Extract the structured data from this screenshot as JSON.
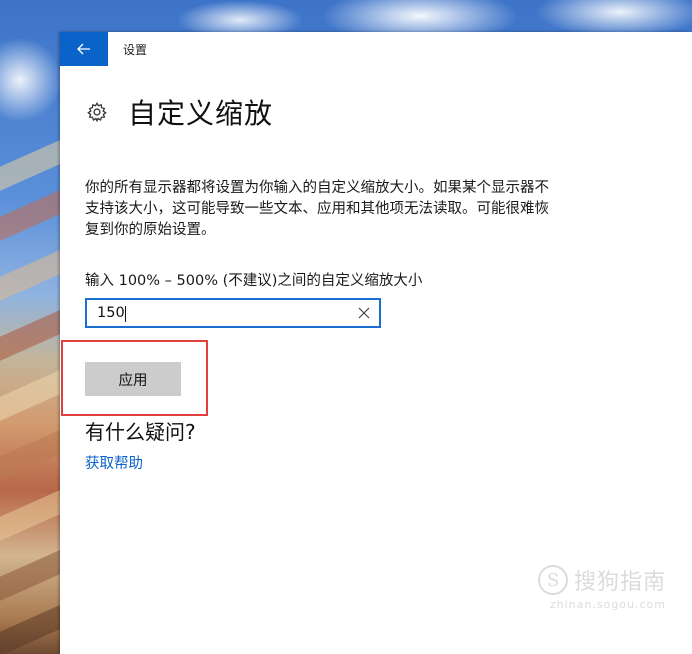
{
  "window": {
    "title": "设置",
    "back_icon": "arrow-left-icon",
    "accent_color": "#0a63c9"
  },
  "page": {
    "icon": "gear-icon",
    "title": "自定义缩放",
    "description": "你的所有显示器都将设置为你输入的自定义缩放大小。如果某个显示器不支持该大小，这可能导致一些文本、应用和其他项无法读取。可能很难恢复到你的原始设置。",
    "input_label": "输入 100% – 500% (不建议)之间的自定义缩放大小",
    "input_value": "150",
    "clear_icon": "close-icon",
    "apply_label": "应用"
  },
  "help": {
    "heading": "有什么疑问?",
    "link": "获取帮助"
  },
  "watermark": {
    "logo_glyph": "S",
    "name": "搜狗指南",
    "url": "zhinan.sogou.com"
  },
  "highlight_color": "#e0413f"
}
